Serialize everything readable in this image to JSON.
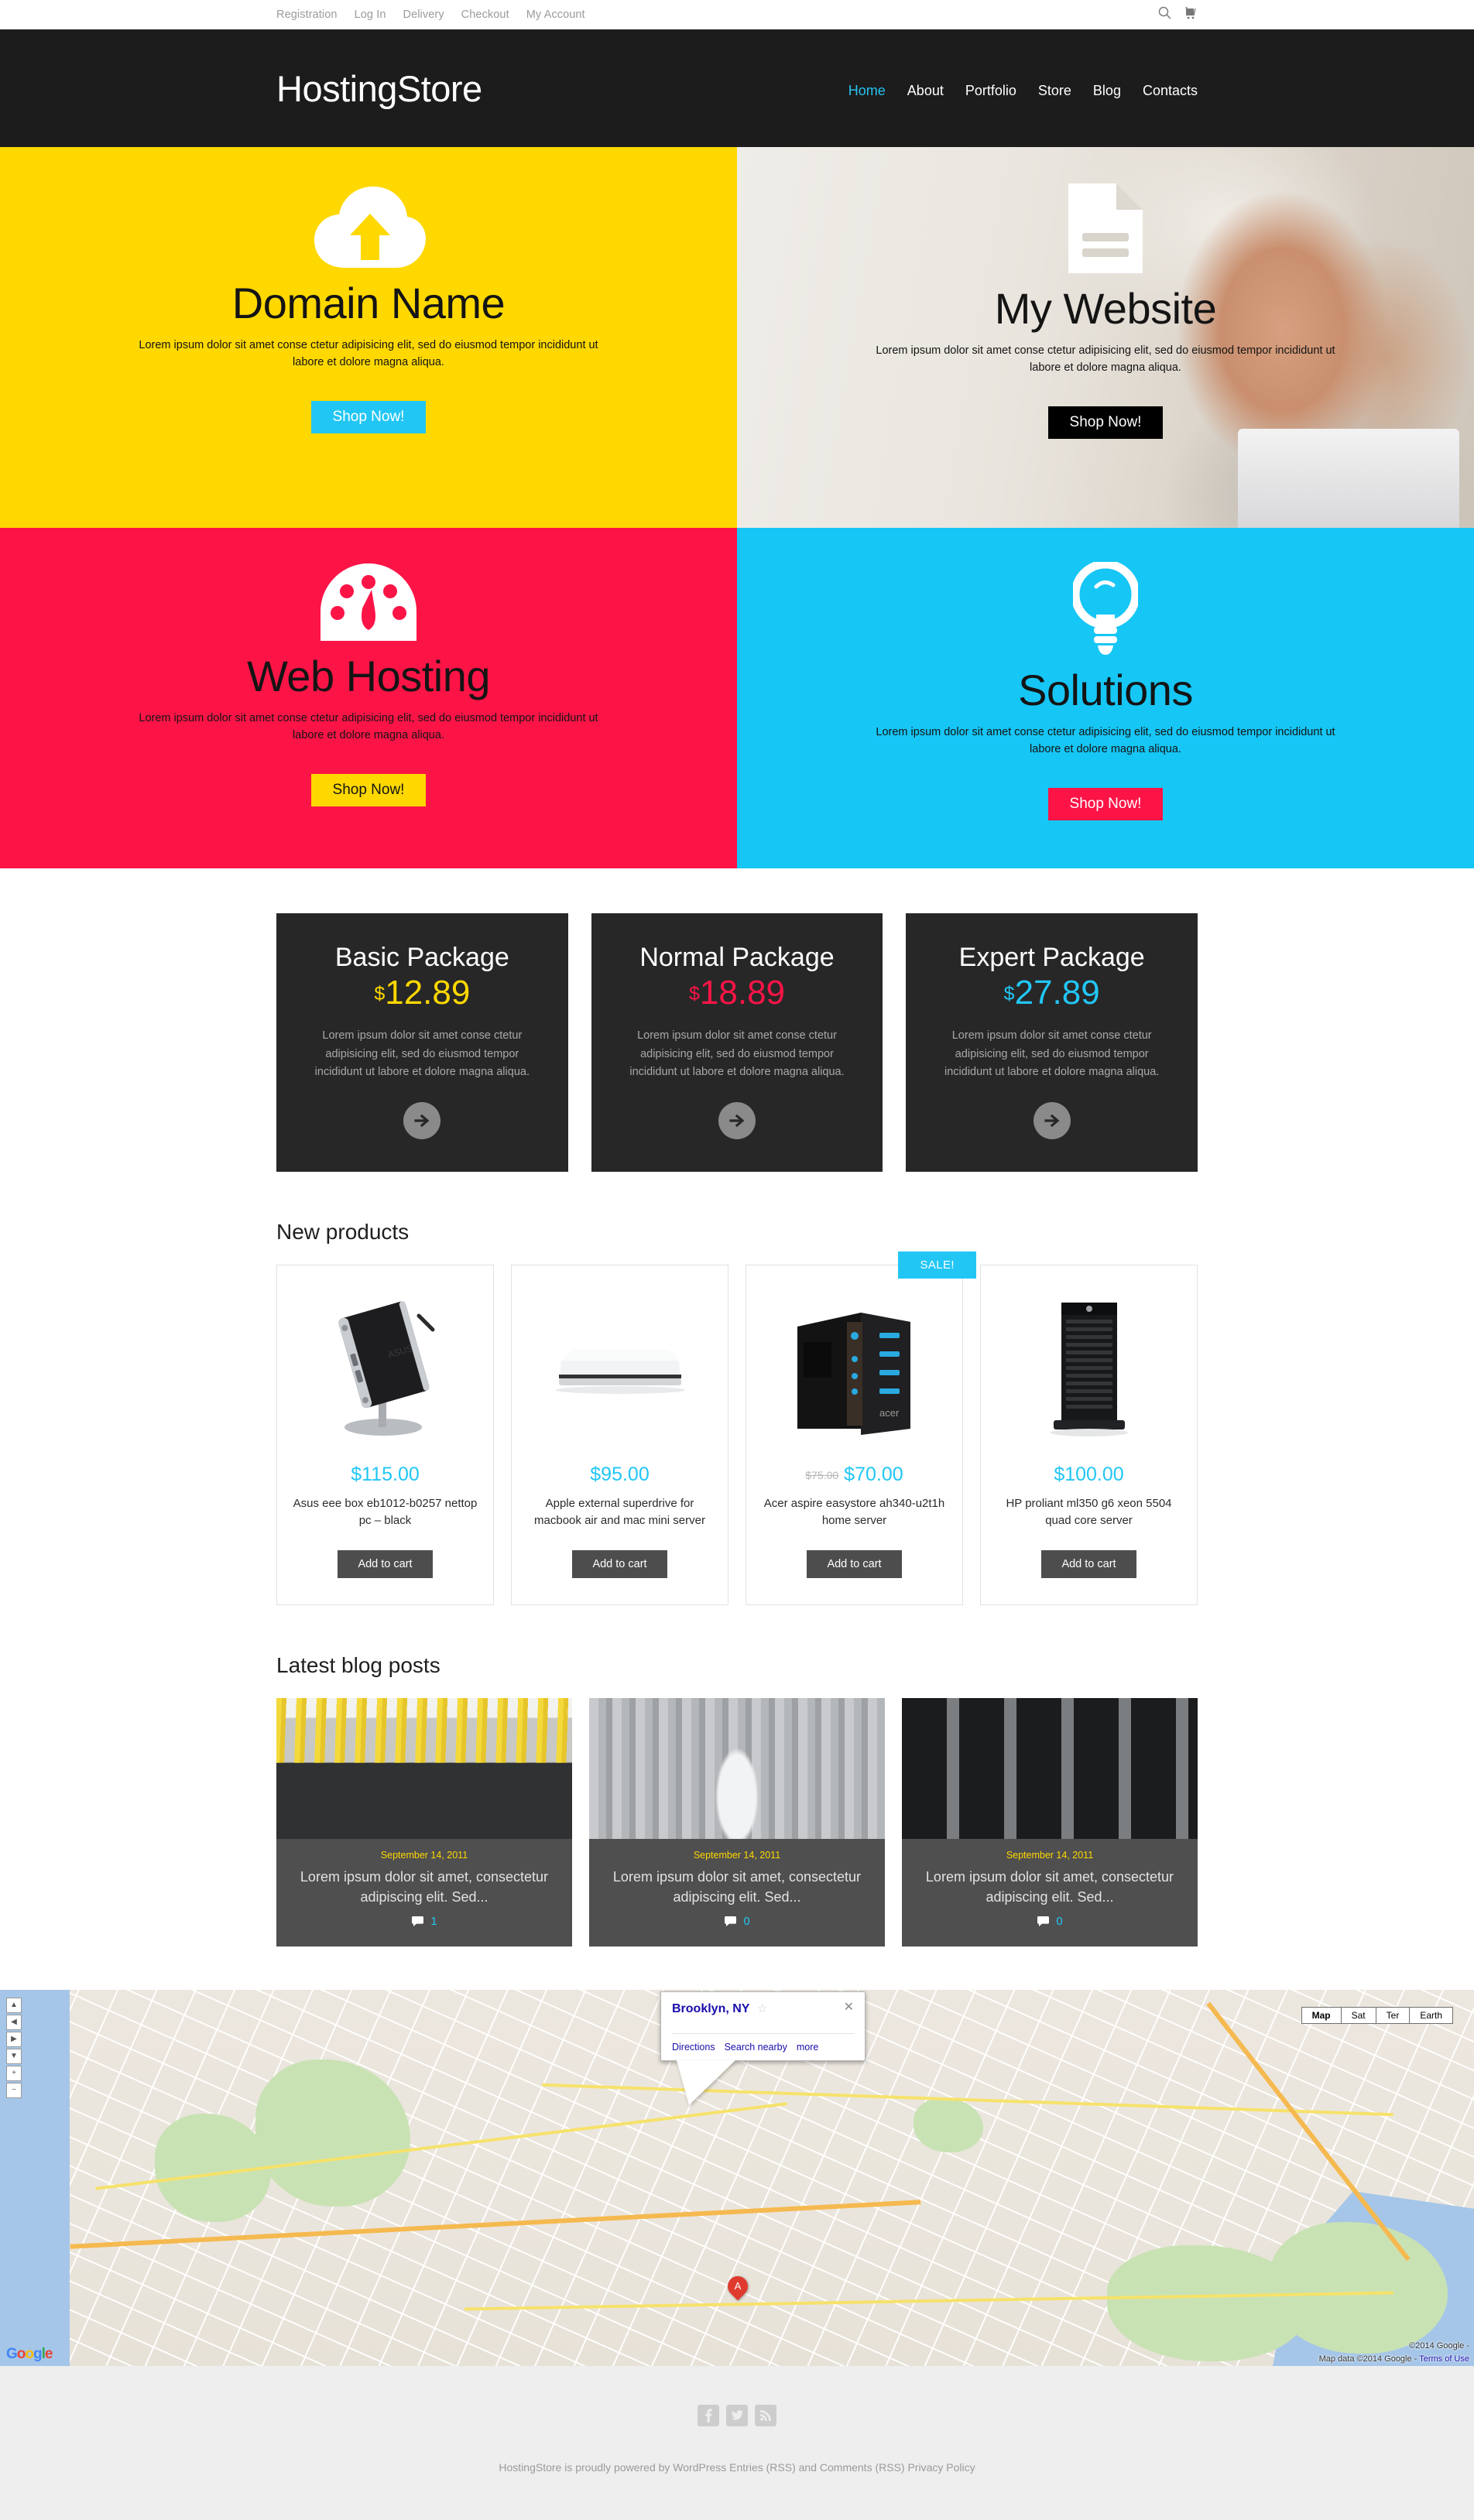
{
  "topbar": {
    "links": [
      "Registration",
      "Log In",
      "Delivery",
      "Checkout",
      "My Account"
    ],
    "search_icon": "search-icon",
    "cart_icon": "cart-icon"
  },
  "header": {
    "logo": "HostingStore",
    "nav": [
      {
        "label": "Home",
        "active": true
      },
      {
        "label": "About",
        "active": false
      },
      {
        "label": "Portfolio",
        "active": false
      },
      {
        "label": "Store",
        "active": false
      },
      {
        "label": "Blog",
        "active": false
      },
      {
        "label": "Contacts",
        "active": false
      }
    ]
  },
  "hero": {
    "body_text": "Lorem ipsum dolor sit amet conse ctetur adipisicing elit, sed do eiusmod tempor incididunt ut labore et dolore magna aliqua.",
    "tiles": [
      {
        "title": "Domain Name",
        "icon": "cloud-upload-icon",
        "button": "Shop Now!",
        "bg": "#ffd800",
        "button_bg": "#22c6f5"
      },
      {
        "title": "My Website",
        "icon": "document-icon",
        "button": "Shop Now!",
        "bg": "photo",
        "button_bg": "#000000"
      },
      {
        "title": "Web Hosting",
        "icon": "speedometer-icon",
        "button": "Shop Now!",
        "bg": "#fc1447",
        "button_bg": "#ffd800"
      },
      {
        "title": "Solutions",
        "icon": "lightbulb-icon",
        "button": "Shop Now!",
        "bg": "#16c6f5",
        "button_bg": "#fc1447"
      }
    ]
  },
  "packages": {
    "desc": "Lorem ipsum dolor sit amet conse ctetur adipisicing elit, sed do eiusmod tempor incididunt ut labore et dolore magna aliqua.",
    "items": [
      {
        "name": "Basic Package",
        "currency": "$",
        "price": "12.89",
        "color": "#ffd800"
      },
      {
        "name": "Normal Package",
        "currency": "$",
        "price": "18.89",
        "color": "#fc1447"
      },
      {
        "name": "Expert Package",
        "currency": "$",
        "price": "27.89",
        "color": "#22c6f5"
      }
    ]
  },
  "products_section": {
    "heading": "New products",
    "add_to_cart": "Add to cart",
    "sale_label": "SALE!",
    "items": [
      {
        "price": "$115.00",
        "old_price": "",
        "title": "Asus eee box eb1012-b0257 nettop pc – black",
        "sale": false,
        "image": "asus-nettop-pc-image"
      },
      {
        "price": "$95.00",
        "old_price": "",
        "title": "Apple external superdrive for macbook air and mac mini server",
        "sale": false,
        "image": "apple-superdrive-image"
      },
      {
        "price": "$70.00",
        "old_price": "$75.00",
        "title": "Acer aspire easystore ah340-u2t1h home server",
        "sale": true,
        "image": "acer-home-server-image"
      },
      {
        "price": "$100.00",
        "old_price": "",
        "title": "HP proliant ml350 g6 xeon 5504 quad core server",
        "sale": false,
        "image": "hp-proliant-server-image"
      }
    ]
  },
  "blog_section": {
    "heading": "Latest blog posts",
    "posts": [
      {
        "date": "September 14, 2011",
        "excerpt": "Lorem ipsum dolor sit amet, consectetur adipiscing elit. Sed...",
        "comments": "1",
        "image": "network-cables-image"
      },
      {
        "date": "September 14, 2011",
        "excerpt": "Lorem ipsum dolor sit amet, consectetur adipiscing elit. Sed...",
        "comments": "0",
        "image": "technician-server-room-image"
      },
      {
        "date": "September 14, 2011",
        "excerpt": "Lorem ipsum dolor sit amet, consectetur adipiscing elit. Sed...",
        "comments": "0",
        "image": "data-center-racks-image"
      }
    ]
  },
  "map": {
    "popup_title": "Brooklyn, NY",
    "popup_actions": [
      "Directions",
      "Search nearby",
      "more"
    ],
    "close_icon": "close-icon",
    "star_icon": "star-icon",
    "types": [
      "Map",
      "Sat",
      "Ter",
      "Earth"
    ],
    "selected_type": "Map",
    "attribution": "©2014 Google -",
    "attribution_data": "Map data ©2014 Google -",
    "terms": "Terms of Use",
    "logo": "Google"
  },
  "footer": {
    "socials": [
      {
        "name": "facebook-icon",
        "glyph": "f"
      },
      {
        "name": "twitter-icon",
        "glyph": "ᵗ"
      },
      {
        "name": "rss-icon",
        "glyph": "◠"
      }
    ],
    "copyright": "HostingStore is proudly powered by WordPress Entries (RSS) and Comments (RSS) Privacy Policy"
  }
}
